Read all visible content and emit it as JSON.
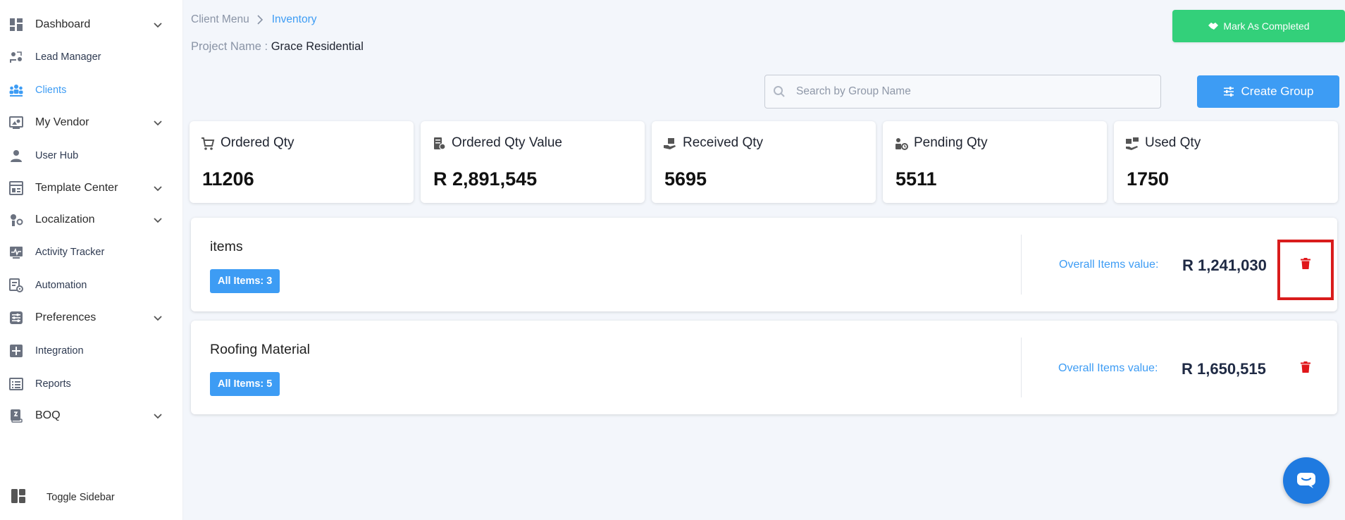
{
  "colors": {
    "accent": "#3d9cf4",
    "success": "#33d07a",
    "danger": "#e0161a"
  },
  "sidebar": {
    "items": [
      {
        "label": "Dashboard",
        "icon": "dashboard-icon",
        "has_chevron": true
      },
      {
        "label": "Lead Manager",
        "icon": "lead-manager-icon",
        "has_chevron": false
      },
      {
        "label": "Clients",
        "icon": "clients-icon",
        "has_chevron": false,
        "active": true
      },
      {
        "label": "My Vendor",
        "icon": "vendor-icon",
        "has_chevron": true
      },
      {
        "label": "User Hub",
        "icon": "user-icon",
        "has_chevron": false
      },
      {
        "label": "Template Center",
        "icon": "template-icon",
        "has_chevron": true
      },
      {
        "label": "Localization",
        "icon": "localization-icon",
        "has_chevron": true
      },
      {
        "label": "Activity Tracker",
        "icon": "activity-icon",
        "has_chevron": false
      },
      {
        "label": "Automation",
        "icon": "automation-icon",
        "has_chevron": false
      },
      {
        "label": "Preferences",
        "icon": "preferences-icon",
        "has_chevron": true
      },
      {
        "label": "Integration",
        "icon": "integration-icon",
        "has_chevron": false
      },
      {
        "label": "Reports",
        "icon": "reports-icon",
        "has_chevron": false
      },
      {
        "label": "BOQ",
        "icon": "boq-icon",
        "has_chevron": true
      }
    ],
    "toggle_label": "Toggle Sidebar"
  },
  "breadcrumb": {
    "parent": "Client Menu",
    "current": "Inventory"
  },
  "project": {
    "label": "Project Name :",
    "value": "Grace Residential"
  },
  "header": {
    "complete_label": "Mark As Completed"
  },
  "search": {
    "placeholder": "Search by Group Name",
    "value": ""
  },
  "create_label": "Create Group",
  "stats": [
    {
      "label": "Ordered Qty",
      "value": "11206",
      "icon": "cart-icon"
    },
    {
      "label": "Ordered Qty Value",
      "value": "R 2,891,545",
      "icon": "receipt-icon"
    },
    {
      "label": "Received Qty",
      "value": "5695",
      "icon": "received-icon"
    },
    {
      "label": "Pending Qty",
      "value": "5511",
      "icon": "pending-icon"
    },
    {
      "label": "Used Qty",
      "value": "1750",
      "icon": "used-icon"
    }
  ],
  "groups": [
    {
      "name": "items",
      "badge": "All Items: 3",
      "overall_label": "Overall Items value:",
      "overall_value": "R 1,241,030"
    },
    {
      "name": "Roofing Material",
      "badge": "All Items: 5",
      "overall_label": "Overall Items value:",
      "overall_value": "R 1,650,515"
    }
  ]
}
